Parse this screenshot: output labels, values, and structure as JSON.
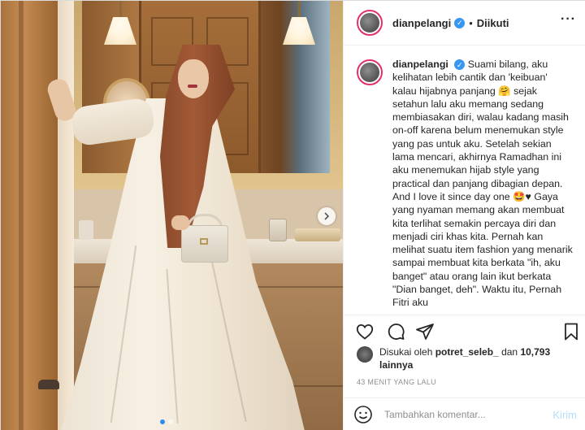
{
  "header": {
    "username": "dianpelangi",
    "separator": "•",
    "follow_state": "Diikuti",
    "more_icon": "more-horizontal-icon"
  },
  "caption": {
    "username": "dianpelangi",
    "text": "Suami bilang, aku kelihatan lebih cantik dan 'keibuan' kalau hijabnya panjang 🤗 sejak setahun lalu aku memang sedang membiasakan diri, walau kadang masih on-off karena belum menemukan style yang pas untuk aku. Setelah sekian lama mencari, akhirnya Ramadhan ini aku menemukan hijab style yang practical dan panjang dibagian depan. And I love it since day one 🤩♥ Gaya yang nyaman memang akan membuat kita terlihat semakin percaya diri dan menjadi ciri khas kita. Pernah kan melihat suatu item fashion yang menarik sampai membuat kita berkata \"ih, aku banget\" atau orang lain ikut berkata \"Dian banget, deh\". Waktu itu, Pernah Fitri aku"
  },
  "actions": {
    "like_icon": "heart-icon",
    "comment_icon": "comment-icon",
    "share_icon": "share-icon",
    "save_icon": "bookmark-icon"
  },
  "likes": {
    "prefix": "Disukai oleh ",
    "user": "potret_seleb_",
    "middle": " dan ",
    "count": "10,793 lainnya"
  },
  "timestamp": "43 MENIT YANG LALU",
  "comment": {
    "placeholder": "Tambahkan komentar...",
    "post_label": "Kirim",
    "emoji_icon": "smiley-icon"
  },
  "carousel": {
    "next_icon": "chevron-right-icon",
    "dot_count": 2,
    "active_index": 0
  },
  "colors": {
    "verified": "#3897f0",
    "link_disabled": "#b2dffc",
    "story_ring": "#e1306c"
  }
}
